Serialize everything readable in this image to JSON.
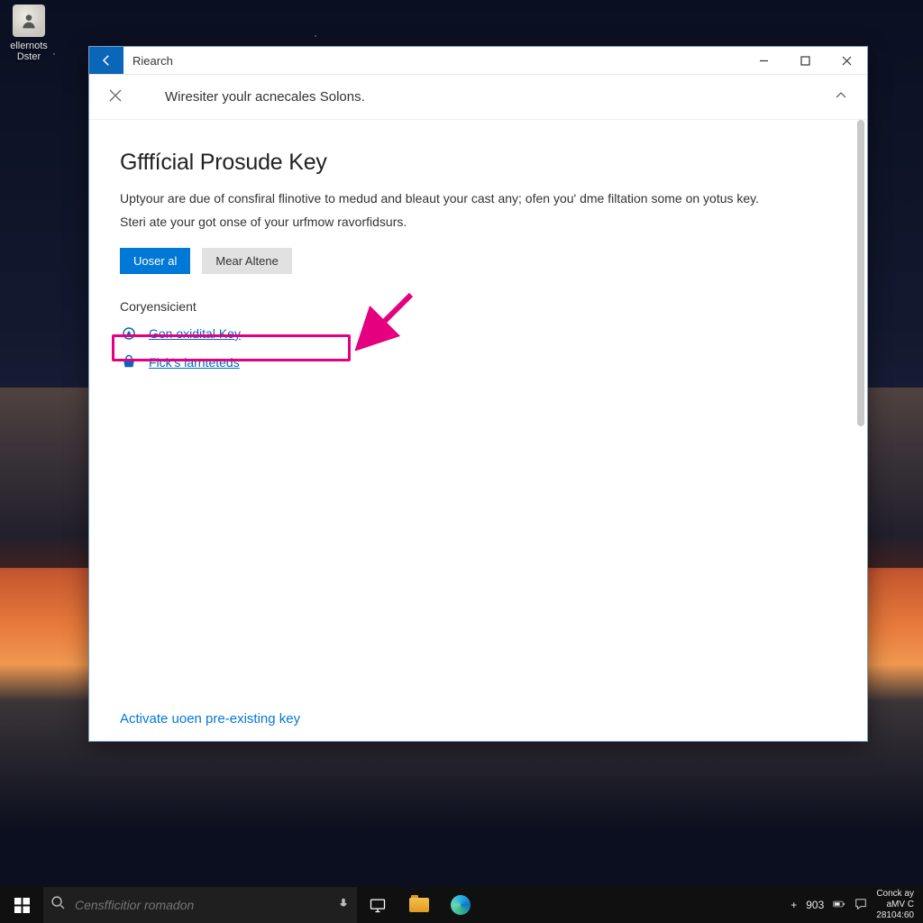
{
  "desktop": {
    "icon_label_line1": "ellernots",
    "icon_label_line2": "Dster"
  },
  "window": {
    "title": "Riearch",
    "banner_text": "Wiresiter youlr acnecales Solons.",
    "page_heading": "Gfffícial Prosude Key",
    "paragraph1": "Uptyour are due of consfiral flinotive to medud and bleaut your cast any; ofen you' dme filtation some on yotus key.",
    "paragraph2": "Steri ate your got onse of your urfmow ravorfidsurs.",
    "btn_primary": "Uoser al",
    "btn_secondary": "Mear Altene",
    "section_label": "Coryensicient",
    "link1": "Gon oxidital Key",
    "link2": "Fick's larnteteds",
    "footer_link": "Activate uoen pre-existing key"
  },
  "taskbar": {
    "search_placeholder": "Censfficitior romadon",
    "tray_plus": "+",
    "tray_num": "903",
    "clock_line1": "Conck ay",
    "clock_line2": "aMV C",
    "clock_line3": "28104:60"
  }
}
